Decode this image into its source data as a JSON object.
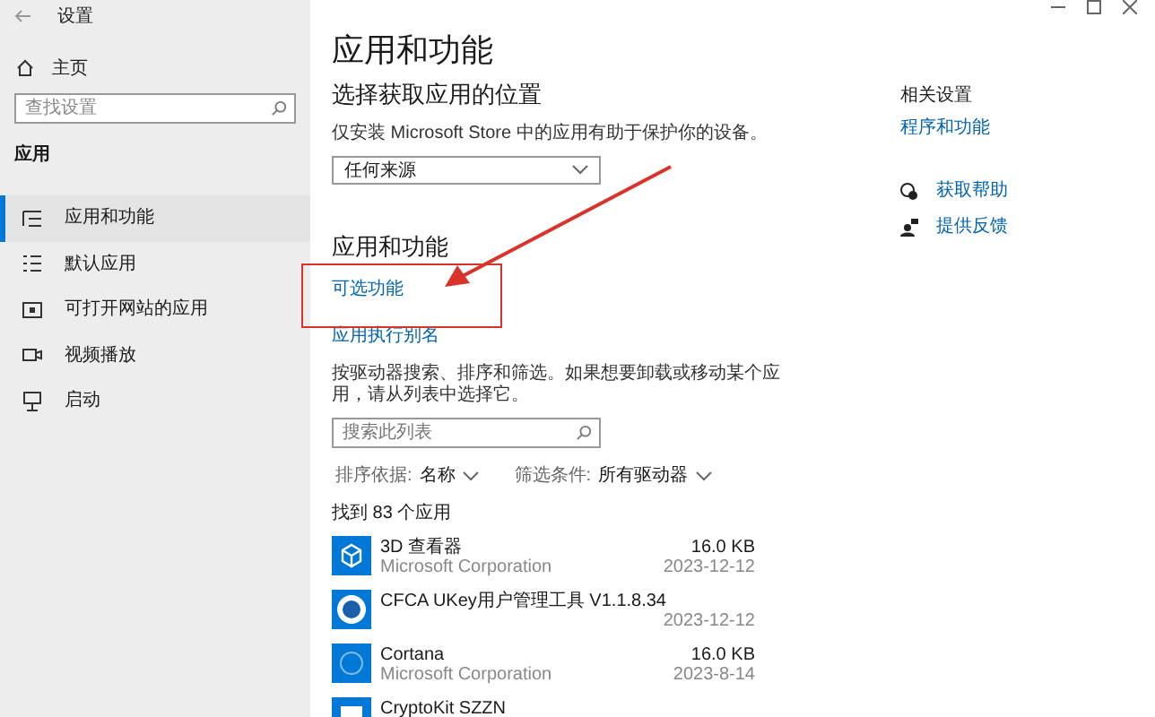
{
  "window": {
    "title": "设置"
  },
  "sidebar": {
    "home": "主页",
    "search": {
      "placeholder": "查找设置"
    },
    "section": "应用",
    "items": [
      {
        "label": "应用和功能",
        "kind": "list",
        "selected": true
      },
      {
        "label": "默认应用",
        "kind": "defaults",
        "selected": false
      },
      {
        "label": "可打开网站的应用",
        "kind": "web",
        "selected": false
      },
      {
        "label": "视频播放",
        "kind": "video",
        "selected": false
      },
      {
        "label": "启动",
        "kind": "startup",
        "selected": false
      }
    ]
  },
  "main": {
    "title": "应用和功能",
    "location": {
      "heading": "选择获取应用的位置",
      "description": "仅安装 Microsoft Store 中的应用有助于保护你的设备。",
      "dropdown": "任何来源"
    },
    "apps": {
      "heading": "应用和功能",
      "links": [
        "可选功能",
        "应用执行别名"
      ],
      "description": "按驱动器搜索、排序和筛选。如果想要卸载或移动某个应用，请从列表中选择它。",
      "search": {
        "placeholder": "搜索此列表"
      },
      "sort": {
        "label": "排序依据:",
        "value": "名称"
      },
      "filter": {
        "label": "筛选条件:",
        "value": "所有驱动器"
      },
      "count": "找到 83 个应用",
      "list": [
        {
          "name": "3D 查看器",
          "publisher": "Microsoft Corporation",
          "size": "16.0 KB",
          "date": "2023-12-12",
          "kind": "cube"
        },
        {
          "name": "CFCA UKey用户管理工具 V1.1.8.34",
          "date": "2023-12-12",
          "kind": "seal"
        },
        {
          "name": "Cortana",
          "publisher": "Microsoft Corporation",
          "size": "16.0 KB",
          "date": "2023-8-14",
          "kind": "ring"
        },
        {
          "name": "CryptoKit SZZN",
          "kind": "kit"
        }
      ]
    }
  },
  "related": {
    "heading": "相关设置",
    "link": "程序和功能",
    "help": [
      {
        "label": "获取帮助",
        "kind": "help"
      },
      {
        "label": "提供反馈",
        "kind": "feedback"
      }
    ]
  }
}
